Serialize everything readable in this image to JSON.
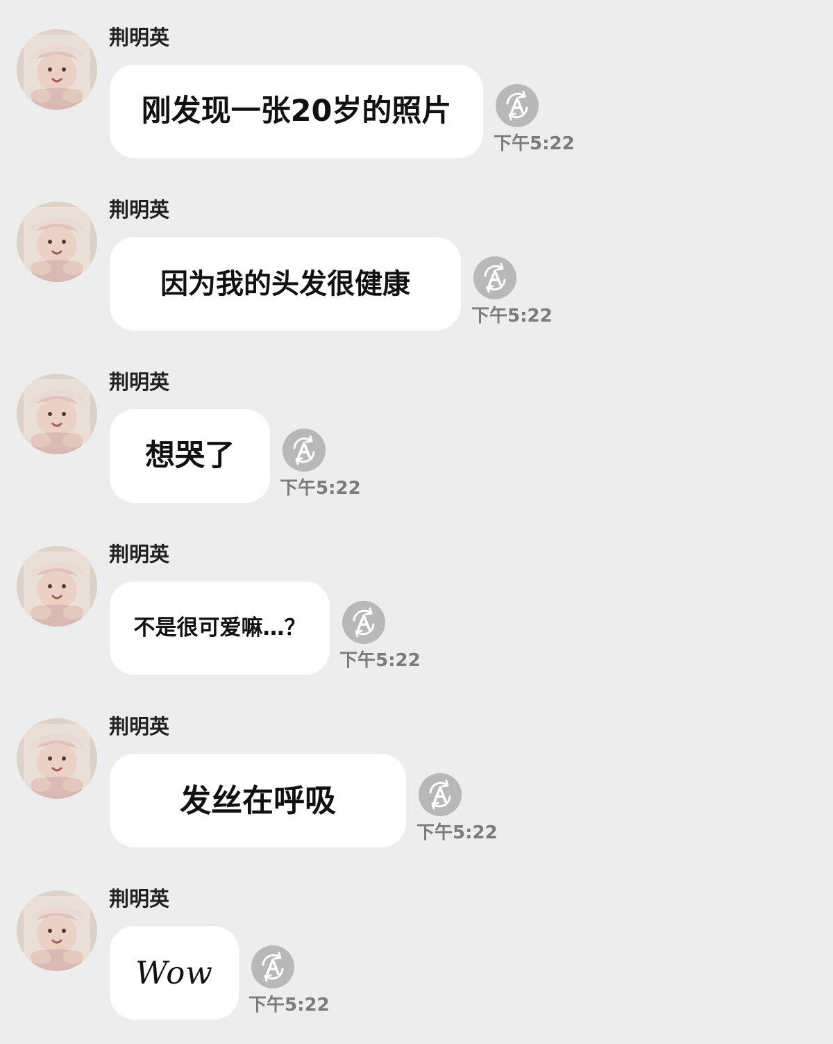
{
  "chat": {
    "messages": [
      {
        "sender": "荆明英",
        "text": "刚发现一张20岁的照片",
        "timestamp": "下午5:22",
        "translate_icon": "translate-a-icon",
        "avatar_icon": "baby-avatar"
      },
      {
        "sender": "荆明英",
        "text": "因为我的头发很健康",
        "timestamp": "下午5:22",
        "translate_icon": "translate-a-icon",
        "avatar_icon": "baby-avatar"
      },
      {
        "sender": "荆明英",
        "text": "想哭了",
        "timestamp": "下午5:22",
        "translate_icon": "translate-a-icon",
        "avatar_icon": "baby-avatar"
      },
      {
        "sender": "荆明英",
        "text": "不是很可爱嘛…？",
        "timestamp": "下午5:22",
        "translate_icon": "translate-a-icon",
        "avatar_icon": "baby-avatar"
      },
      {
        "sender": "荆明英",
        "text": "发丝在呼吸",
        "timestamp": "下午5:22",
        "translate_icon": "translate-a-icon",
        "avatar_icon": "baby-avatar"
      },
      {
        "sender": "荆明英",
        "text": "Wow",
        "timestamp": "下午5:22",
        "translate_icon": "translate-a-icon",
        "avatar_icon": "baby-avatar"
      }
    ]
  },
  "colors": {
    "background": "#ededed",
    "bubble": "#ffffff",
    "sender_text": "#202020",
    "message_text": "#111111",
    "timestamp": "#7b7b7b",
    "translate_icon": "#b8b8b8"
  }
}
